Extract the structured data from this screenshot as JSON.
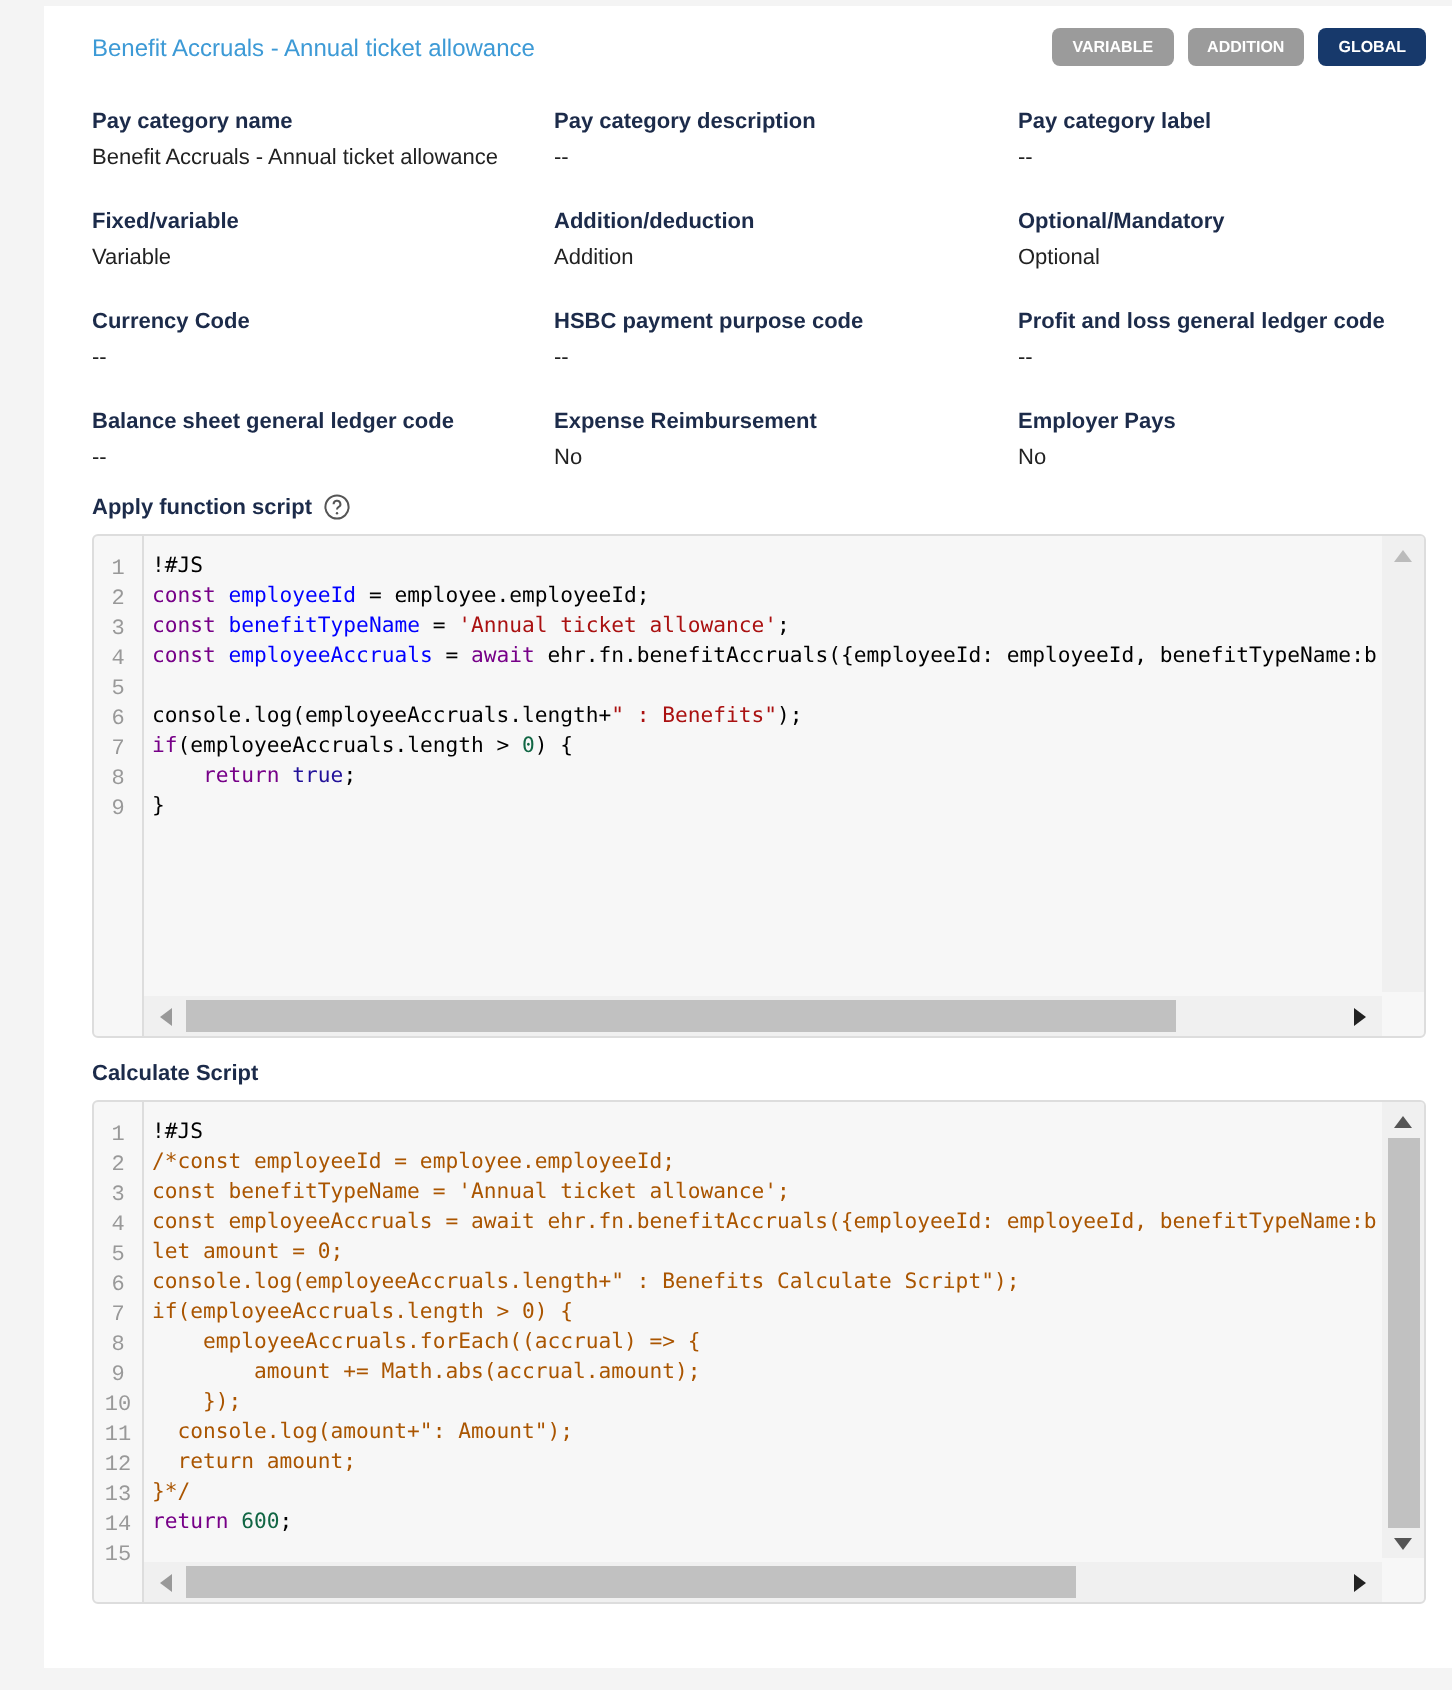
{
  "header": {
    "title": "Benefit Accruals - Annual ticket allowance",
    "badges": [
      {
        "label": "VARIABLE",
        "selected": false
      },
      {
        "label": "ADDITION",
        "selected": false
      },
      {
        "label": "GLOBAL",
        "selected": true
      }
    ]
  },
  "fields": [
    {
      "label": "Pay category name",
      "value": "Benefit Accruals - Annual ticket allowance"
    },
    {
      "label": "Pay category description",
      "value": "--"
    },
    {
      "label": "Pay category label",
      "value": "--"
    },
    {
      "label": "Fixed/variable",
      "value": "Variable"
    },
    {
      "label": "Addition/deduction",
      "value": "Addition"
    },
    {
      "label": "Optional/Mandatory",
      "value": "Optional"
    },
    {
      "label": "Currency Code",
      "value": "--"
    },
    {
      "label": "HSBC payment purpose code",
      "value": "--"
    },
    {
      "label": "Profit and loss general ledger code",
      "value": "--"
    },
    {
      "label": "Balance sheet general ledger code",
      "value": "--"
    },
    {
      "label": "Expense Reimbursement",
      "value": "No"
    },
    {
      "label": "Employer Pays",
      "value": "No"
    }
  ],
  "scripts": [
    {
      "title": "Apply function script",
      "help": true,
      "lines": [
        {
          "number": "1",
          "tokens": [
            {
              "text": "!#JS",
              "kind": "plain"
            }
          ]
        },
        {
          "number": "2",
          "tokens": [
            {
              "text": "const ",
              "kind": "keyword"
            },
            {
              "text": "employeeId",
              "kind": "def"
            },
            {
              "text": " = employee.employeeId;",
              "kind": "plain"
            }
          ]
        },
        {
          "number": "3",
          "tokens": [
            {
              "text": "const ",
              "kind": "keyword"
            },
            {
              "text": "benefitTypeName",
              "kind": "def"
            },
            {
              "text": " = ",
              "kind": "plain"
            },
            {
              "text": "'Annual ticket allowance'",
              "kind": "string"
            },
            {
              "text": ";",
              "kind": "plain"
            }
          ]
        },
        {
          "number": "4",
          "tokens": [
            {
              "text": "const ",
              "kind": "keyword"
            },
            {
              "text": "employeeAccruals",
              "kind": "def"
            },
            {
              "text": " = ",
              "kind": "plain"
            },
            {
              "text": "await",
              "kind": "keyword"
            },
            {
              "text": " ehr.fn.benefitAccruals({employeeId: employeeId, benefitTypeName:b",
              "kind": "plain"
            }
          ]
        },
        {
          "number": "5"
        },
        {
          "number": "6",
          "tokens": [
            {
              "text": "console.log(employeeAccruals.length+",
              "kind": "plain"
            },
            {
              "text": "\" : Benefits\"",
              "kind": "string"
            },
            {
              "text": ");",
              "kind": "plain"
            }
          ]
        },
        {
          "number": "7",
          "tokens": [
            {
              "text": "if",
              "kind": "keyword"
            },
            {
              "text": "(employeeAccruals.length > ",
              "kind": "plain"
            },
            {
              "text": "0",
              "kind": "number"
            },
            {
              "text": ") {",
              "kind": "plain"
            }
          ]
        },
        {
          "number": "8",
          "tokens": [
            {
              "text": "    return ",
              "kind": "keyword"
            },
            {
              "text": "true",
              "kind": "atom"
            },
            {
              "text": ";",
              "kind": "plain"
            }
          ]
        },
        {
          "number": "9",
          "tokens": [
            {
              "text": "}",
              "kind": "plain"
            }
          ]
        }
      ]
    },
    {
      "title": "Calculate Script",
      "help": false,
      "lines": [
        {
          "number": "1",
          "tokens": [
            {
              "text": "!#JS",
              "kind": "plain"
            }
          ]
        },
        {
          "number": "2",
          "tokens": [
            {
              "text": "/*const employeeId = employee.employeeId;",
              "kind": "comment"
            }
          ]
        },
        {
          "number": "3",
          "tokens": [
            {
              "text": "const benefitTypeName = 'Annual ticket allowance';",
              "kind": "comment"
            }
          ]
        },
        {
          "number": "4",
          "tokens": [
            {
              "text": "const employeeAccruals = await ehr.fn.benefitAccruals({employeeId: employeeId, benefitTypeName:b",
              "kind": "comment"
            }
          ]
        },
        {
          "number": "5",
          "tokens": [
            {
              "text": "let amount = 0;",
              "kind": "comment"
            }
          ]
        },
        {
          "number": "6",
          "tokens": [
            {
              "text": "console.log(employeeAccruals.length+\" : Benefits Calculate Script\");",
              "kind": "comment"
            }
          ]
        },
        {
          "number": "7",
          "tokens": [
            {
              "text": "if(employeeAccruals.length > 0) {",
              "kind": "comment"
            }
          ]
        },
        {
          "number": "8",
          "tokens": [
            {
              "text": "    employeeAccruals.forEach((accrual) => {",
              "kind": "comment"
            }
          ]
        },
        {
          "number": "9",
          "tokens": [
            {
              "text": "        amount += Math.abs(accrual.amount);",
              "kind": "comment"
            }
          ]
        },
        {
          "number": "10",
          "tokens": [
            {
              "text": "    });",
              "kind": "comment"
            }
          ]
        },
        {
          "number": "11",
          "tokens": [
            {
              "text": "  console.log(amount+\": Amount\");",
              "kind": "comment"
            }
          ]
        },
        {
          "number": "12",
          "tokens": [
            {
              "text": "  return amount;",
              "kind": "comment"
            }
          ]
        },
        {
          "number": "13",
          "tokens": [
            {
              "text": "}*/",
              "kind": "comment"
            }
          ]
        },
        {
          "number": "14",
          "tokens": [
            {
              "text": "return ",
              "kind": "keyword"
            },
            {
              "text": "600",
              "kind": "number"
            },
            {
              "text": ";",
              "kind": "plain"
            }
          ]
        },
        {
          "number": "15"
        }
      ]
    }
  ]
}
